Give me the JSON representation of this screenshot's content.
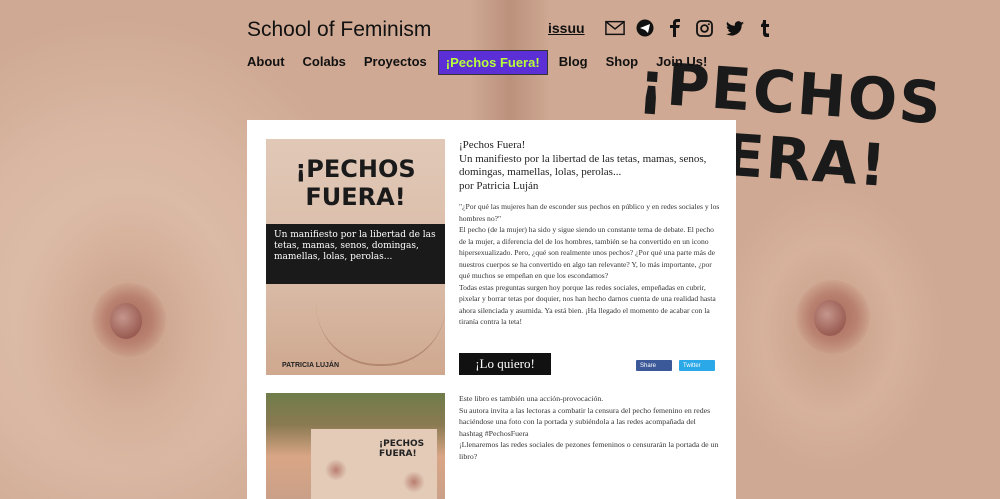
{
  "site": {
    "title": "School of Feminism"
  },
  "social": {
    "issuu": "issuu",
    "icons": [
      "mail-icon",
      "telegram-icon",
      "facebook-icon",
      "instagram-icon",
      "twitter-icon",
      "tumblr-icon"
    ]
  },
  "nav": [
    {
      "label": "About"
    },
    {
      "label": "Colabs"
    },
    {
      "label": "Proyectos"
    },
    {
      "label": "¡Pechos Fuera!"
    },
    {
      "label": "Blog"
    },
    {
      "label": "Shop"
    },
    {
      "label": "Join Us!"
    }
  ],
  "background": {
    "headline_line1": "¡PECHOS",
    "headline_line2": "FUERA!"
  },
  "book": {
    "cover_title_1": "¡PECHOS",
    "cover_title_2": "FUERA!",
    "cover_subtitle": "Un manifiesto por la libertad de las tetas, mamas, senos, domingas, mamellas, lolas, perolas...",
    "cover_author": "PATRICIA LUJÁN",
    "title": "¡Pechos Fuera!",
    "subtitle": "Un manifiesto por la libertad de las tetas, mamas, senos, domingas, mamellas, lolas, perolas...",
    "author": "por Patricia Luján",
    "quote": "\"¿Por qué las mujeres han de esconder sus pechos en público y en redes sociales y los hombres no?\"",
    "para1": "El pecho (de la mujer) ha sido y sigue siendo un constante tema de debate. El pecho de la mujer, a diferencia del de los hombres, también se ha convertido en un icono hipersexualizado. Pero, ¿qué son realmente unos pechos? ¿Por qué una parte más de nuestros cuerpos se ha convertido en algo tan relevante? Y, lo más importante, ¿por qué muchos se empeñan en que los escondamos?",
    "para2": "Todas estas preguntas surgen hoy porque las redes sociales, empeñadas en cubrir, pixelar y borrar tetas por doquier, nos han hecho darnos cuenta de una realidad hasta ahora silenciada y asumida. Ya está bien. ¡Ha llegado el momento de acabar con la tiranía contra la teta!",
    "buy_label": "¡Lo quiero!",
    "share_fb": "Share",
    "share_tw": "Twitter"
  },
  "campaign": {
    "line1": "Este libro es también una acción-provocación.",
    "line2": "Su autora invita a las lectoras a combatir la censura del pecho femenino en redes haciéndose una foto con la portada y subiéndola a las redes acompañada del hashtag #PechosFuera",
    "line3": "¡Llenaremos las redes sociales de pezones femeninos o censurarán la portada de un libro?",
    "photo_book_title_1": "¡PECHOS",
    "photo_book_title_2": "FUERA!"
  },
  "colors": {
    "accent": "#5b2ed6",
    "accent_text": "#b8ff3a"
  }
}
